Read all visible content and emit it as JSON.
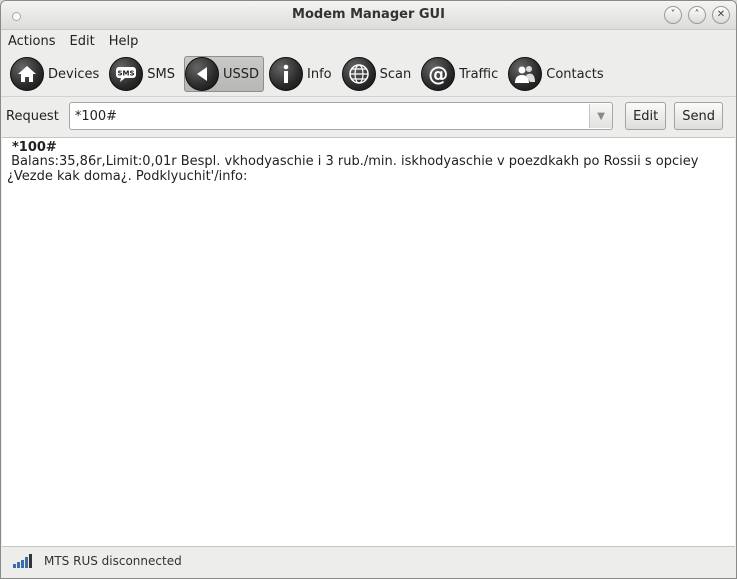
{
  "window": {
    "title": "Modem Manager GUI"
  },
  "window_buttons": [
    "˅",
    "˄",
    "✕"
  ],
  "menu": [
    "Actions",
    "Edit",
    "Help"
  ],
  "toolbar": [
    {
      "label": "Devices",
      "icon": "home-icon",
      "active": false
    },
    {
      "label": "SMS",
      "icon": "sms-icon",
      "active": false
    },
    {
      "label": "USSD",
      "icon": "ussd-icon",
      "active": true
    },
    {
      "label": "Info",
      "icon": "info-icon",
      "active": false
    },
    {
      "label": "Scan",
      "icon": "scan-icon",
      "active": false
    },
    {
      "label": "Traffic",
      "icon": "traffic-icon",
      "active": false
    },
    {
      "label": "Contacts",
      "icon": "contacts-icon",
      "active": false
    }
  ],
  "request": {
    "label": "Request",
    "value": "*100#",
    "edit_label": "Edit",
    "send_label": "Send"
  },
  "response": {
    "command": "*100#",
    "answer": " Balans:35,86r,Limit:0,01r Bespl. vkhodyaschie i 3 rub./min. iskhodyaschie v poezdkakh po Rossii s opciey ¿Vezde kak doma¿. Podklyuchit'/info:"
  },
  "status": {
    "text": "MTS RUS disconnected"
  }
}
